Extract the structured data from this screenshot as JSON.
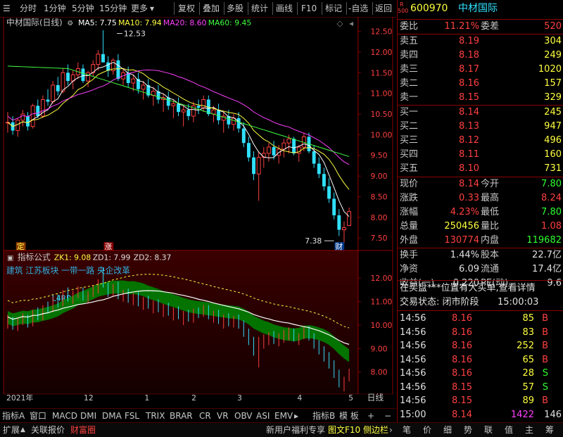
{
  "toolbar": {
    "items": [
      "分时",
      "1分钟",
      "5分钟",
      "15分钟",
      "更多",
      "复权",
      "叠加",
      "多股",
      "统计",
      "画线",
      "F10",
      "标记",
      "-自选",
      "返回"
    ]
  },
  "main_chart": {
    "title": "中材国际(日线)",
    "ma": [
      {
        "label": "MA5: 7.75",
        "color": "#ffffff"
      },
      {
        "label": "MA10: 7.94",
        "color": "#ffff40"
      },
      {
        "label": "MA20: 8.60",
        "color": "#ff40ff"
      },
      {
        "label": "MA60: 9.45",
        "color": "#40ff40"
      }
    ],
    "high_label": "12.53",
    "low_label": "7.38",
    "cai_marker": "财",
    "ding_marker": "定",
    "zhang_marker": "涨",
    "y_ticks": [
      "12.50",
      "12.00",
      "11.50",
      "11.00",
      "10.50",
      "10.00",
      "9.50",
      "9.00",
      "8.50",
      "8.00",
      "7.50"
    ]
  },
  "indicator": {
    "title": "指标公式",
    "zk": "ZK1: 9.08",
    "zd1": "ZD1: 7.99",
    "zd2": "ZD2: 8.37",
    "tags": "建筑 江苏板块 一带一路 央企改革",
    "note": "L4RR 高抛",
    "y_ticks": [
      "12.00",
      "11.00",
      "10.00",
      "9.00",
      "8.00"
    ]
  },
  "x_axis": {
    "labels": [
      "2021年",
      "12",
      "1",
      "2",
      "3",
      "4",
      "5"
    ],
    "period": "日线"
  },
  "indicator_tabs": [
    "指标A",
    "窗口",
    "MACD",
    "DMI",
    "DMA",
    "FSL",
    "TRIX",
    "BRAR",
    "CR",
    "VR",
    "OBV",
    "ASI",
    "EMV",
    "指标B",
    "模 板",
    "+",
    "−"
  ],
  "bottom_bar": {
    "left": [
      "扩展",
      "关联报价",
      "财富圈"
    ],
    "right": [
      "新用户福利专享",
      "图文F10",
      "侧边栏"
    ],
    "tabs": [
      "笔",
      "价",
      "细",
      "势",
      "联",
      "值",
      "主",
      "筹"
    ]
  },
  "quote": {
    "badge_r": "R",
    "badge_num": "500",
    "code": "600970",
    "name": "中材国际",
    "weibi_label": "委比",
    "weibi": "11.21%",
    "weicha_label": "委差",
    "weicha": "520",
    "sells": [
      {
        "label": "卖五",
        "price": "8.19",
        "vol": "304"
      },
      {
        "label": "卖四",
        "price": "8.18",
        "vol": "249"
      },
      {
        "label": "卖三",
        "price": "8.17",
        "vol": "1020"
      },
      {
        "label": "卖二",
        "price": "8.16",
        "vol": "157"
      },
      {
        "label": "卖一",
        "price": "8.15",
        "vol": "329"
      }
    ],
    "buys": [
      {
        "label": "买一",
        "price": "8.14",
        "vol": "245"
      },
      {
        "label": "买二",
        "price": "8.13",
        "vol": "947"
      },
      {
        "label": "买三",
        "price": "8.12",
        "vol": "496"
      },
      {
        "label": "买四",
        "price": "8.11",
        "vol": "160"
      },
      {
        "label": "买五",
        "price": "8.10",
        "vol": "731"
      }
    ],
    "stats": [
      {
        "l1": "现价",
        "v1": "8.14",
        "c1": "red",
        "l2": "今开",
        "v2": "7.80",
        "c2": "grn"
      },
      {
        "l1": "涨跌",
        "v1": "0.33",
        "c1": "red",
        "l2": "最高",
        "v2": "8.24",
        "c2": "red"
      },
      {
        "l1": "涨幅",
        "v1": "4.23%",
        "c1": "red",
        "l2": "最低",
        "v2": "7.80",
        "c2": "grn"
      },
      {
        "l1": "总量",
        "v1": "250456",
        "c1": "yel",
        "l2": "量比",
        "v2": "1.08",
        "c2": "red"
      },
      {
        "l1": "外盘",
        "v1": "130774",
        "c1": "red",
        "l2": "内盘",
        "v2": "119682",
        "c2": "grn"
      }
    ],
    "stats2": [
      {
        "l1": "换手",
        "v1": "1.44%",
        "l2": "股本",
        "v2": "22.7亿"
      },
      {
        "l1": "净资",
        "v1": "6.09",
        "l2": "流通",
        "v2": "17.4亿"
      },
      {
        "l1": "收益(一)",
        "v1": "0.220",
        "l2": "PE(动)",
        "v2": "9.6"
      }
    ],
    "notice": "在买盘***位置有大买单,查看详情",
    "status_label": "交易状态: 闭市阶段",
    "status_time": "15:00:03",
    "ticks": [
      {
        "t": "14:56",
        "p": "8.16",
        "v": "85",
        "s": "B"
      },
      {
        "t": "14:56",
        "p": "8.16",
        "v": "83",
        "s": "B"
      },
      {
        "t": "14:56",
        "p": "8.16",
        "v": "252",
        "s": "B"
      },
      {
        "t": "14:56",
        "p": "8.16",
        "v": "65",
        "s": "B"
      },
      {
        "t": "14:56",
        "p": "8.16",
        "v": "28",
        "s": "S"
      },
      {
        "t": "14:56",
        "p": "8.15",
        "v": "57",
        "s": "S"
      },
      {
        "t": "14:56",
        "p": "8.15",
        "v": "89",
        "s": "B"
      },
      {
        "t": "15:00",
        "p": "8.14",
        "v": "1422",
        "s": "146"
      }
    ]
  },
  "colors": {
    "up": "#ff4040",
    "down": "#30e0ff",
    "panel_border": "#8b0000",
    "ma5": "#ffffff",
    "ma10": "#ffff40",
    "ma20": "#ff40ff",
    "ma60": "#40ff40",
    "band": "#008000"
  },
  "candles": {
    "ohlc": [
      [
        10.3,
        10.55,
        10.05,
        10.3
      ],
      [
        10.3,
        10.45,
        10.0,
        10.1
      ],
      [
        10.1,
        10.4,
        9.95,
        10.35
      ],
      [
        10.35,
        10.6,
        10.2,
        10.5
      ],
      [
        10.45,
        10.55,
        10.1,
        10.2
      ],
      [
        10.2,
        10.75,
        10.15,
        10.7
      ],
      [
        10.7,
        10.85,
        10.4,
        10.45
      ],
      [
        10.45,
        10.95,
        10.4,
        10.85
      ],
      [
        10.85,
        11.1,
        10.7,
        10.8
      ],
      [
        10.8,
        11.3,
        10.75,
        11.2
      ],
      [
        11.2,
        11.4,
        10.95,
        11.05
      ],
      [
        11.05,
        11.6,
        11.0,
        11.5
      ],
      [
        11.5,
        11.7,
        11.2,
        11.3
      ],
      [
        11.3,
        11.55,
        11.1,
        11.45
      ],
      [
        11.45,
        11.75,
        11.35,
        11.6
      ],
      [
        11.6,
        11.7,
        11.25,
        11.3
      ],
      [
        11.3,
        11.55,
        11.15,
        11.5
      ],
      [
        11.5,
        11.8,
        11.4,
        11.7
      ],
      [
        11.7,
        12.05,
        11.55,
        11.95
      ],
      [
        11.95,
        12.53,
        11.8,
        11.75
      ],
      [
        11.75,
        11.9,
        11.4,
        11.55
      ],
      [
        11.55,
        11.85,
        11.45,
        11.8
      ],
      [
        11.8,
        11.95,
        11.3,
        11.35
      ],
      [
        11.35,
        11.6,
        11.2,
        11.5
      ],
      [
        11.5,
        11.65,
        11.15,
        11.25
      ],
      [
        11.25,
        11.45,
        11.05,
        11.35
      ],
      [
        11.35,
        11.5,
        11.0,
        11.1
      ],
      [
        11.1,
        11.3,
        10.85,
        11.2
      ],
      [
        11.2,
        11.35,
        10.9,
        10.95
      ],
      [
        10.95,
        11.15,
        10.7,
        11.05
      ],
      [
        11.05,
        11.2,
        10.75,
        10.85
      ],
      [
        10.85,
        11.0,
        10.55,
        10.9
      ],
      [
        10.9,
        11.05,
        10.6,
        10.7
      ],
      [
        10.7,
        10.85,
        10.4,
        10.75
      ],
      [
        10.75,
        10.9,
        10.45,
        10.55
      ],
      [
        10.55,
        10.7,
        10.2,
        10.6
      ],
      [
        10.6,
        10.75,
        10.35,
        10.45
      ],
      [
        10.45,
        10.8,
        10.3,
        10.7
      ],
      [
        10.7,
        10.85,
        10.5,
        10.65
      ],
      [
        10.65,
        10.95,
        10.55,
        10.85
      ],
      [
        10.85,
        10.95,
        10.45,
        10.5
      ],
      [
        10.5,
        10.7,
        10.3,
        10.6
      ],
      [
        10.6,
        10.75,
        10.25,
        10.35
      ],
      [
        10.35,
        10.55,
        10.05,
        10.45
      ],
      [
        10.45,
        10.6,
        10.15,
        10.25
      ],
      [
        10.25,
        10.5,
        10.1,
        10.4
      ],
      [
        10.4,
        10.55,
        10.05,
        10.15
      ],
      [
        10.15,
        10.3,
        9.7,
        9.8
      ],
      [
        9.8,
        9.95,
        9.35,
        9.45
      ],
      [
        9.45,
        9.6,
        8.9,
        9.05
      ],
      [
        9.05,
        9.6,
        8.4,
        9.45
      ],
      [
        9.45,
        9.7,
        9.2,
        9.55
      ],
      [
        9.55,
        9.8,
        9.35,
        9.7
      ],
      [
        9.7,
        9.85,
        9.4,
        9.5
      ],
      [
        9.5,
        9.75,
        9.3,
        9.65
      ],
      [
        9.65,
        9.9,
        9.45,
        9.8
      ],
      [
        9.8,
        10.0,
        9.55,
        9.9
      ],
      [
        9.9,
        9.95,
        9.5,
        9.55
      ],
      [
        9.55,
        9.75,
        9.35,
        9.7
      ],
      [
        9.7,
        10.05,
        9.6,
        9.95
      ],
      [
        9.95,
        10.05,
        9.55,
        9.6
      ],
      [
        9.6,
        9.75,
        9.2,
        9.3
      ],
      [
        9.3,
        9.45,
        8.95,
        9.05
      ],
      [
        9.05,
        9.2,
        8.65,
        8.75
      ],
      [
        8.75,
        8.95,
        8.35,
        8.45
      ],
      [
        8.45,
        8.6,
        7.95,
        8.05
      ],
      [
        8.05,
        8.2,
        7.55,
        7.7
      ],
      [
        7.7,
        7.9,
        7.38,
        7.75
      ],
      [
        7.8,
        8.24,
        7.8,
        8.14
      ]
    ]
  }
}
